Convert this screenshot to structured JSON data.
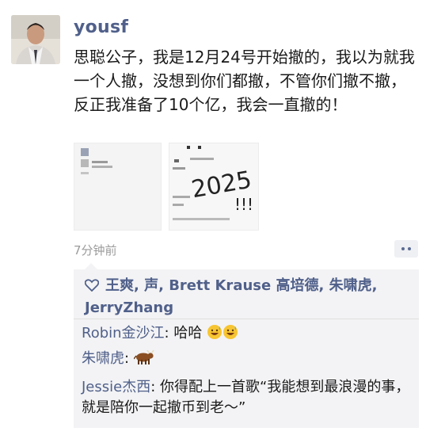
{
  "post": {
    "author": "yousf",
    "text": "思聪公子，我是12月24号开始撤的，我以为就我一个人撤，没想到你们都撤，不管你们撤不撤，反正我准备了10个亿，我会一直撤的！",
    "time": "7分钟前",
    "images": [
      {
        "icon": "chat-screenshot-image"
      },
      {
        "icon": "handwritten-note-image",
        "overlay_text": "2025",
        "overlay_marks": "!!!"
      }
    ]
  },
  "likes": {
    "names": "王爽, 声, Brett Krause 高培德, 朱啸虎, JerryZhang"
  },
  "comments": [
    {
      "name": "Robin金沙江",
      "sep": ": ",
      "text": "哈哈",
      "emoji": "grinning-sweat-emoji x2"
    },
    {
      "name": "朱啸虎",
      "sep": ": ",
      "text": "",
      "emoji": "ox-emoji"
    },
    {
      "name": "Jessie杰西",
      "sep": ": ",
      "text": "你得配上一首歌“我能想到最浪漫的事，就是陪你一起撤币到老～”"
    }
  ],
  "colors": {
    "link": "#50608a",
    "panel": "#f3f3f5",
    "muted": "#9b9b9b"
  }
}
